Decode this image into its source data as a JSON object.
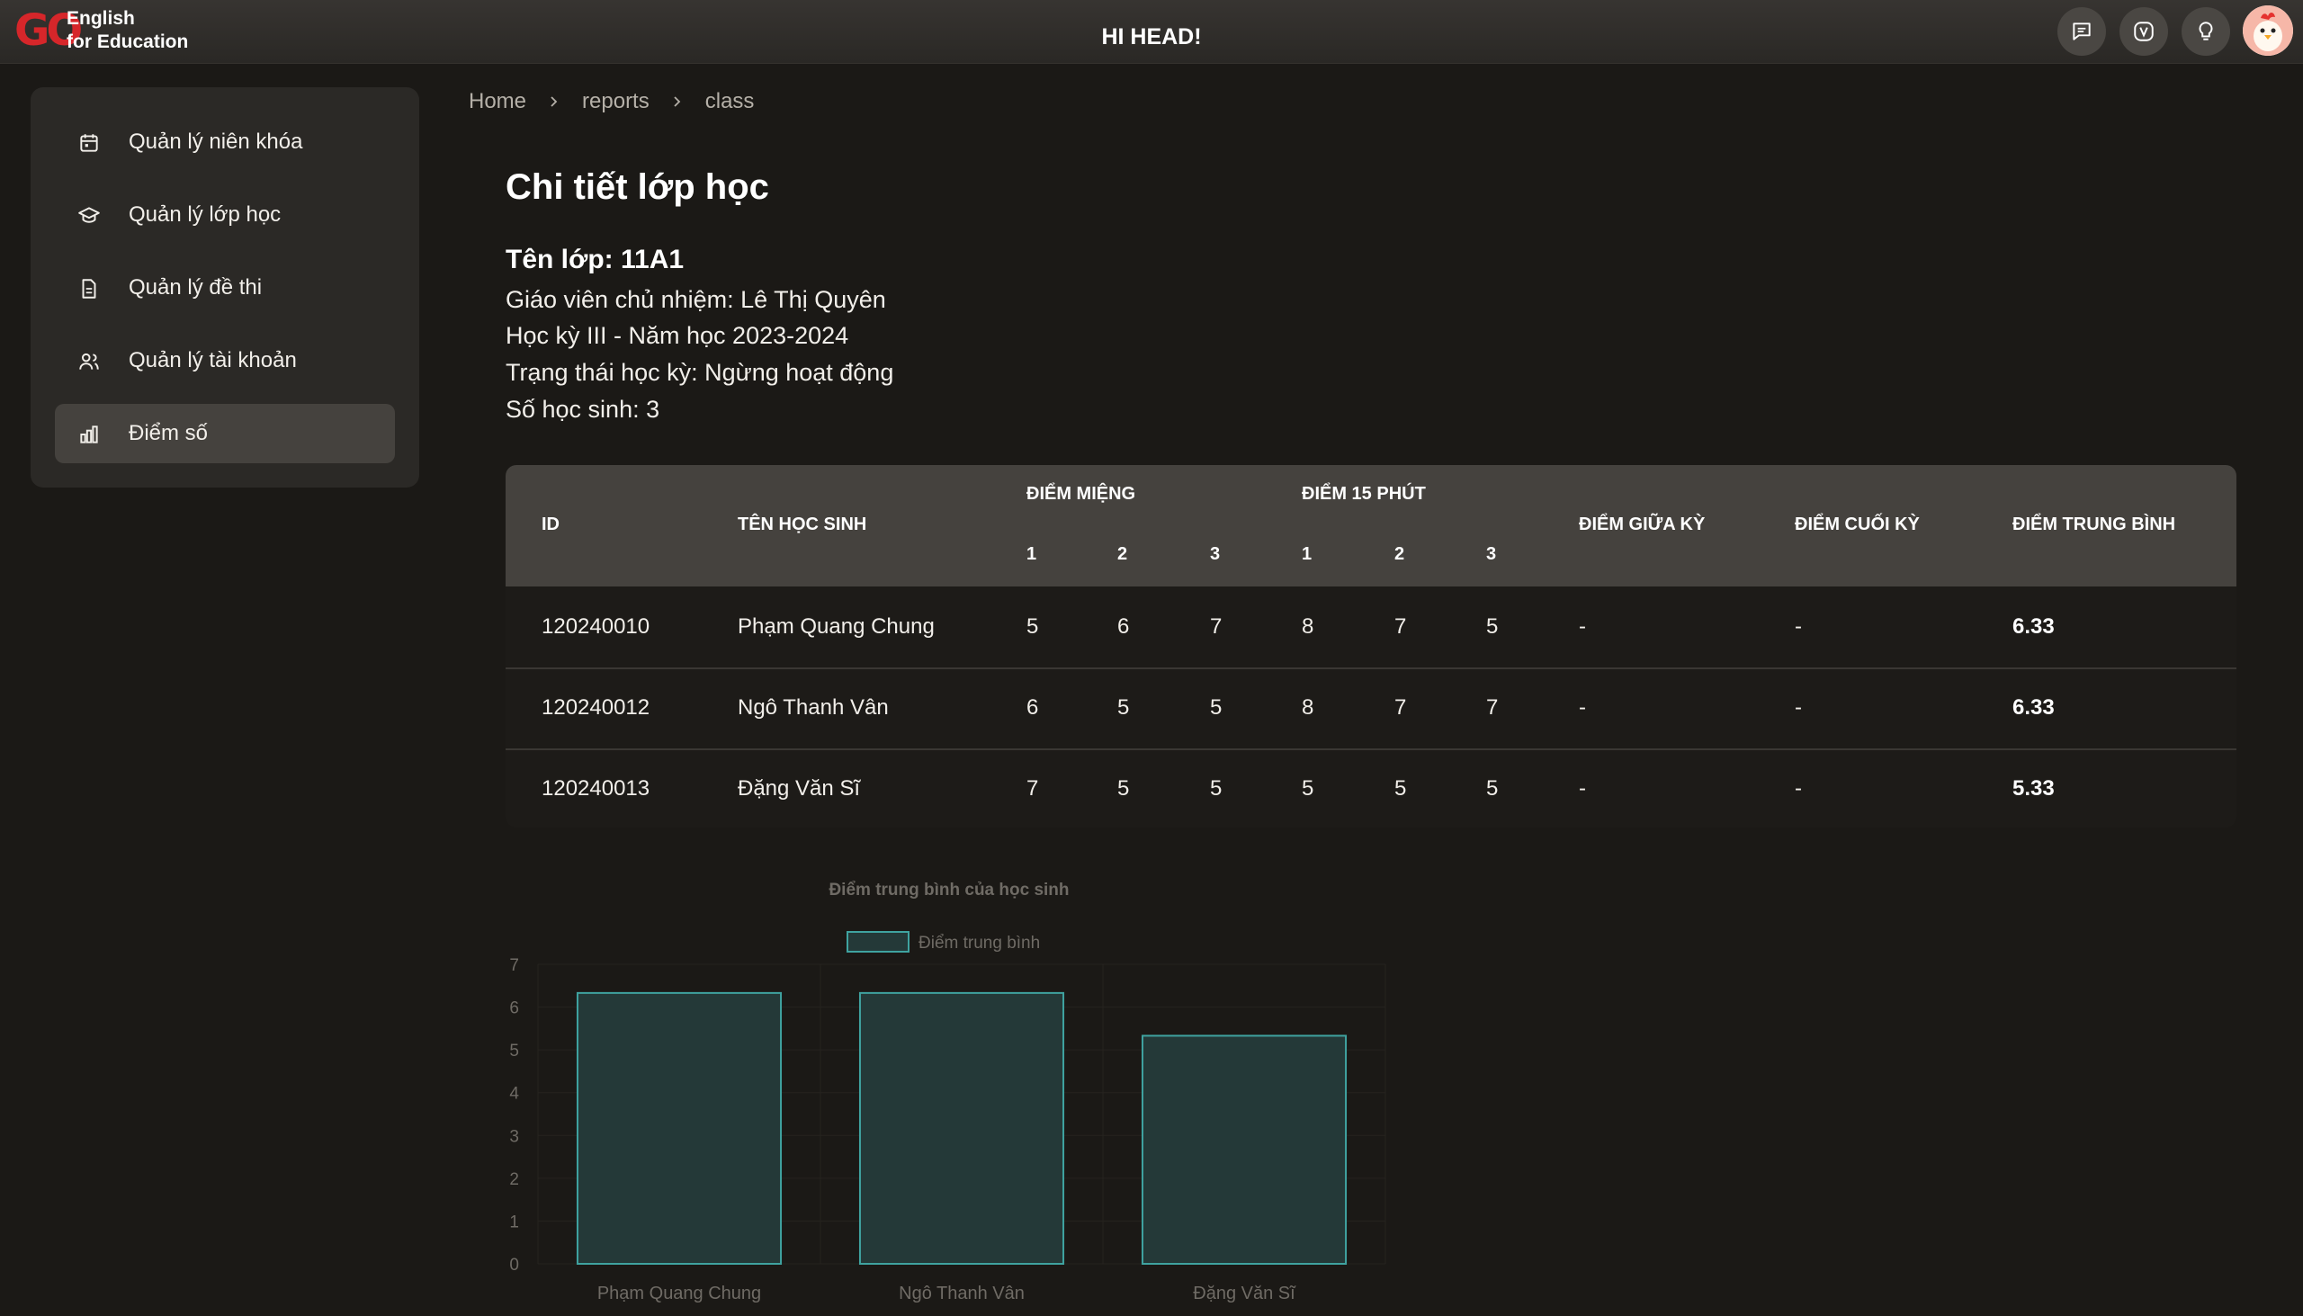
{
  "header": {
    "logo_mark": "GO",
    "logo_line1": "English",
    "logo_line2": "for Education",
    "greeting": "HI HEAD!",
    "icons": [
      "chat-icon",
      "v-badge-icon",
      "lightbulb-icon",
      "avatar"
    ]
  },
  "sidebar": {
    "items": [
      {
        "label": "Quản lý niên khóa",
        "icon": "calendar-icon",
        "active": false
      },
      {
        "label": "Quản lý lớp học",
        "icon": "graduation-cap-icon",
        "active": false
      },
      {
        "label": "Quản lý đề thi",
        "icon": "document-icon",
        "active": false
      },
      {
        "label": "Quản lý tài khoản",
        "icon": "users-icon",
        "active": false
      },
      {
        "label": "Điểm số",
        "icon": "bar-chart-icon",
        "active": true
      }
    ]
  },
  "breadcrumb": [
    "Home",
    "reports",
    "class"
  ],
  "page": {
    "title": "Chi tiết lớp học",
    "class_name": "Tên lớp: 11A1",
    "teacher": "Giáo viên chủ nhiệm: Lê Thị Quyên",
    "term": "Học kỳ III - Năm học 2023-2024",
    "status": "Trạng thái học kỳ: Ngừng hoạt động",
    "student_count": "Số học sinh: 3"
  },
  "table": {
    "headers": {
      "id": "ID",
      "name": "TÊN HỌC SINH",
      "oral": "ĐIỂM MIỆNG",
      "quiz15": "ĐIỂM 15 PHÚT",
      "sub": [
        "1",
        "2",
        "3"
      ],
      "midterm": "ĐIỂM GIỮA KỲ",
      "final": "ĐIỂM CUỐI KỲ",
      "average": "ĐIỂM TRUNG BÌNH"
    },
    "rows": [
      {
        "id": "120240010",
        "name": "Phạm Quang Chung",
        "oral": [
          "5",
          "6",
          "7"
        ],
        "quiz": [
          "8",
          "7",
          "5"
        ],
        "midterm": "-",
        "final": "-",
        "average": "6.33"
      },
      {
        "id": "120240012",
        "name": "Ngô Thanh Vân",
        "oral": [
          "6",
          "5",
          "5"
        ],
        "quiz": [
          "8",
          "7",
          "7"
        ],
        "midterm": "-",
        "final": "-",
        "average": "6.33"
      },
      {
        "id": "120240013",
        "name": "Đặng Văn Sĩ",
        "oral": [
          "7",
          "5",
          "5"
        ],
        "quiz": [
          "5",
          "5",
          "5"
        ],
        "midterm": "-",
        "final": "-",
        "average": "5.33"
      }
    ]
  },
  "chart_data": {
    "type": "bar",
    "title": "Điểm trung bình của học sinh",
    "categories": [
      "Phạm Quang Chung",
      "Ngô Thanh Vân",
      "Đặng Văn Sĩ"
    ],
    "series": [
      {
        "name": "Điểm trung bình",
        "values": [
          6.33,
          6.33,
          5.33
        ]
      }
    ],
    "ylim": [
      0,
      7
    ],
    "yticks": [
      "0",
      "1",
      "2",
      "3",
      "4",
      "5",
      "6",
      "7"
    ],
    "xlabel": "",
    "ylabel": "",
    "grid": true,
    "legend": "top",
    "bar_fill": "#243938",
    "bar_stroke": "#3fa3a0"
  },
  "colors": {
    "background": "#1b1916",
    "panel": "#2b2926",
    "active_item": "#45423e",
    "brand_red": "#d6262a"
  }
}
